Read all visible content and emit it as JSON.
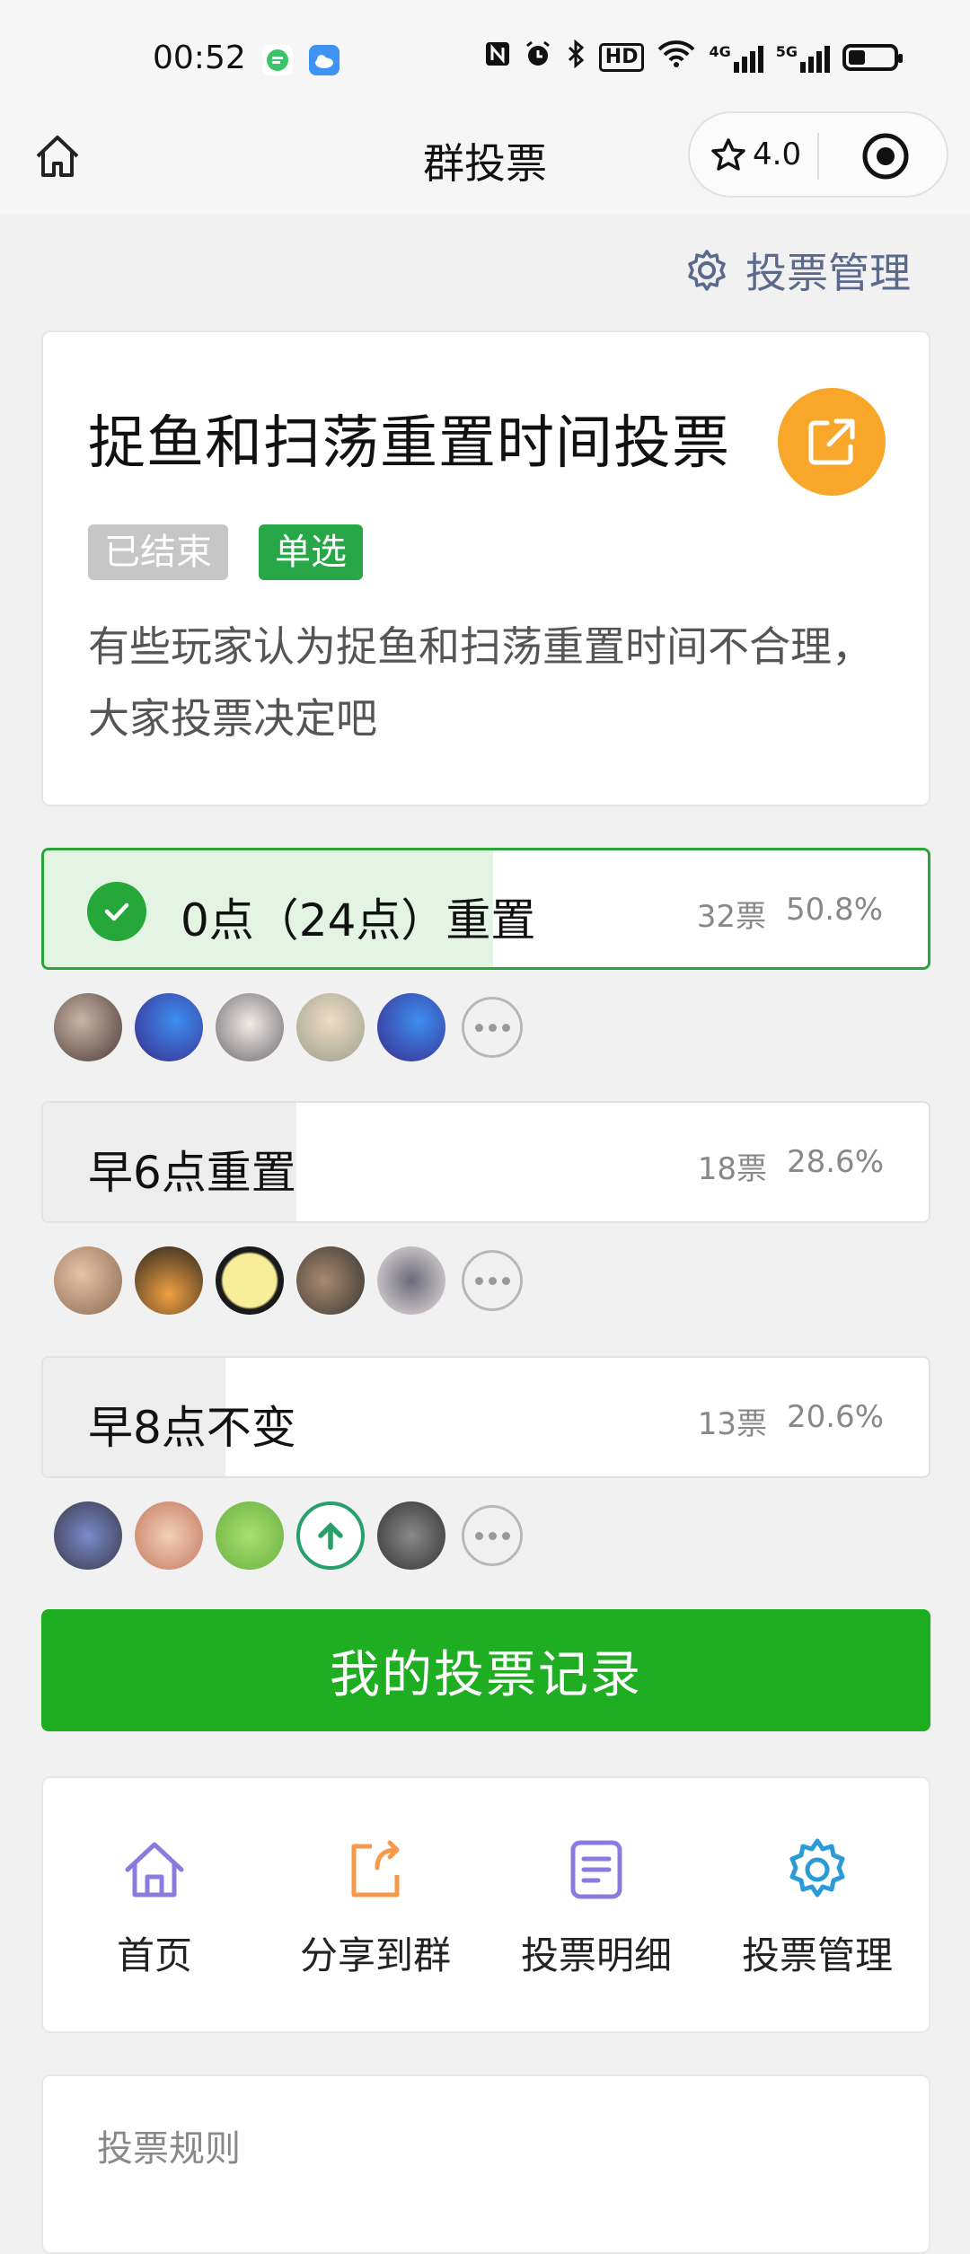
{
  "status_bar": {
    "time": "00:52",
    "network_a": "4G",
    "network_b": "5G",
    "hd": "HD"
  },
  "nav": {
    "title": "群投票",
    "rating": "4.0"
  },
  "manage_link": "投票管理",
  "poll": {
    "title": "捉鱼和扫荡重置时间投票",
    "tags": {
      "status": "已结束",
      "type": "单选"
    },
    "description": "有些玩家认为捉鱼和扫荡重置时间不合理，大家投票决定吧"
  },
  "options": [
    {
      "label": "0点（24点）重置",
      "votes": "32票",
      "percent": "50.8%",
      "fraction": 0.508,
      "selected": true
    },
    {
      "label": "早6点重置",
      "votes": "18票",
      "percent": "28.6%",
      "fraction": 0.286,
      "selected": false
    },
    {
      "label": "早8点不变",
      "votes": "13票",
      "percent": "20.6%",
      "fraction": 0.206,
      "selected": false
    }
  ],
  "my_record_button": "我的投票记录",
  "actions": [
    {
      "label": "首页",
      "icon": "home-icon",
      "color": "#8a7be0"
    },
    {
      "label": "分享到群",
      "icon": "share-icon",
      "color": "#f59a4a"
    },
    {
      "label": "投票明细",
      "icon": "document-icon",
      "color": "#8a7be0"
    },
    {
      "label": "投票管理",
      "icon": "gear-icon",
      "color": "#2a9bd8"
    }
  ],
  "rules_title": "投票规则",
  "colors": {
    "primary_green": "#1fad22",
    "share_orange": "#f9a72a",
    "link_blue_gray": "#5a6a8c"
  }
}
